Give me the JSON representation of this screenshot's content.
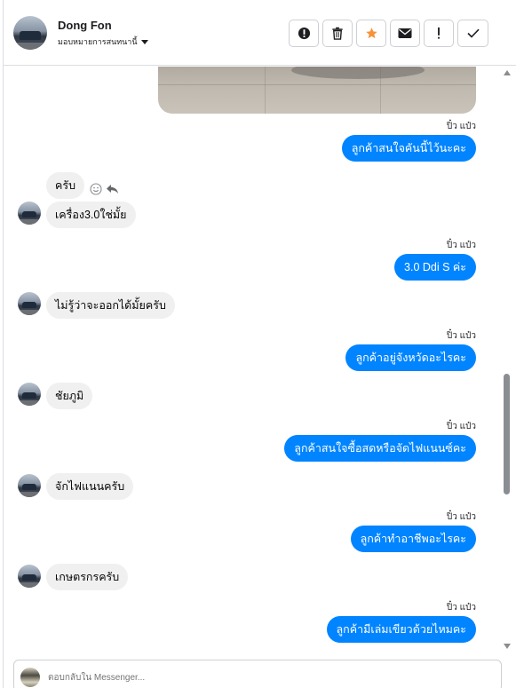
{
  "header": {
    "contact_name": "Dong Fon",
    "assign_label": "มอบหมายการสนทนานี้",
    "toolbar": [
      {
        "name": "report-spam",
        "icon": "alert-circle-icon"
      },
      {
        "name": "delete",
        "icon": "trash-icon"
      },
      {
        "name": "star",
        "icon": "star-icon",
        "color": "#f7923a"
      },
      {
        "name": "mark-unread",
        "icon": "envelope-icon"
      },
      {
        "name": "follow-up",
        "icon": "exclamation-icon"
      },
      {
        "name": "mark-done",
        "icon": "check-icon"
      }
    ]
  },
  "conversation": {
    "messages": [
      {
        "from": "page",
        "seen_label": "ปิ๋ว แป๋ว",
        "text": "ลูกค้าสนใจคันนี้ไว้นะคะ"
      },
      {
        "from": "customer",
        "text": "ครับ"
      },
      {
        "from": "customer",
        "text": "เครื่อง3.0ใช่มั้ย"
      },
      {
        "from": "page",
        "seen_label": "ปิ๋ว แป๋ว",
        "text": "3.0 Ddi S  ค่ะ"
      },
      {
        "from": "customer",
        "text": "ไม่รู้ว่าจะออกได้มั้ยครับ"
      },
      {
        "from": "page",
        "seen_label": "ปิ๋ว แป๋ว",
        "text": "ลูกค้าอยู่จังหวัดอะไรคะ"
      },
      {
        "from": "customer",
        "text": "ชัยภูมิ"
      },
      {
        "from": "page",
        "seen_label": "ปิ๋ว แป๋ว",
        "text": "ลูกค้าสนใจซื้อสดหรือจัดไฟแนนซ์คะ"
      },
      {
        "from": "customer",
        "text": "จักไฟแนนครับ"
      },
      {
        "from": "page",
        "seen_label": "ปิ๋ว แป๋ว",
        "text": "ลูกค้าทำอาชีพอะไรคะ"
      },
      {
        "from": "customer",
        "text": "เกษตรกรครับ"
      },
      {
        "from": "page",
        "seen_label": "ปิ๋ว แป๋ว",
        "text": "ลูกค้ามีเล่มเขียวด้วยไหมคะ"
      }
    ]
  },
  "composer": {
    "placeholder": "ตอบกลับใน Messenger..."
  },
  "colors": {
    "outgoing_bubble": "#0084ff",
    "incoming_bubble": "#f0f0f0",
    "star_accent": "#f7923a"
  }
}
